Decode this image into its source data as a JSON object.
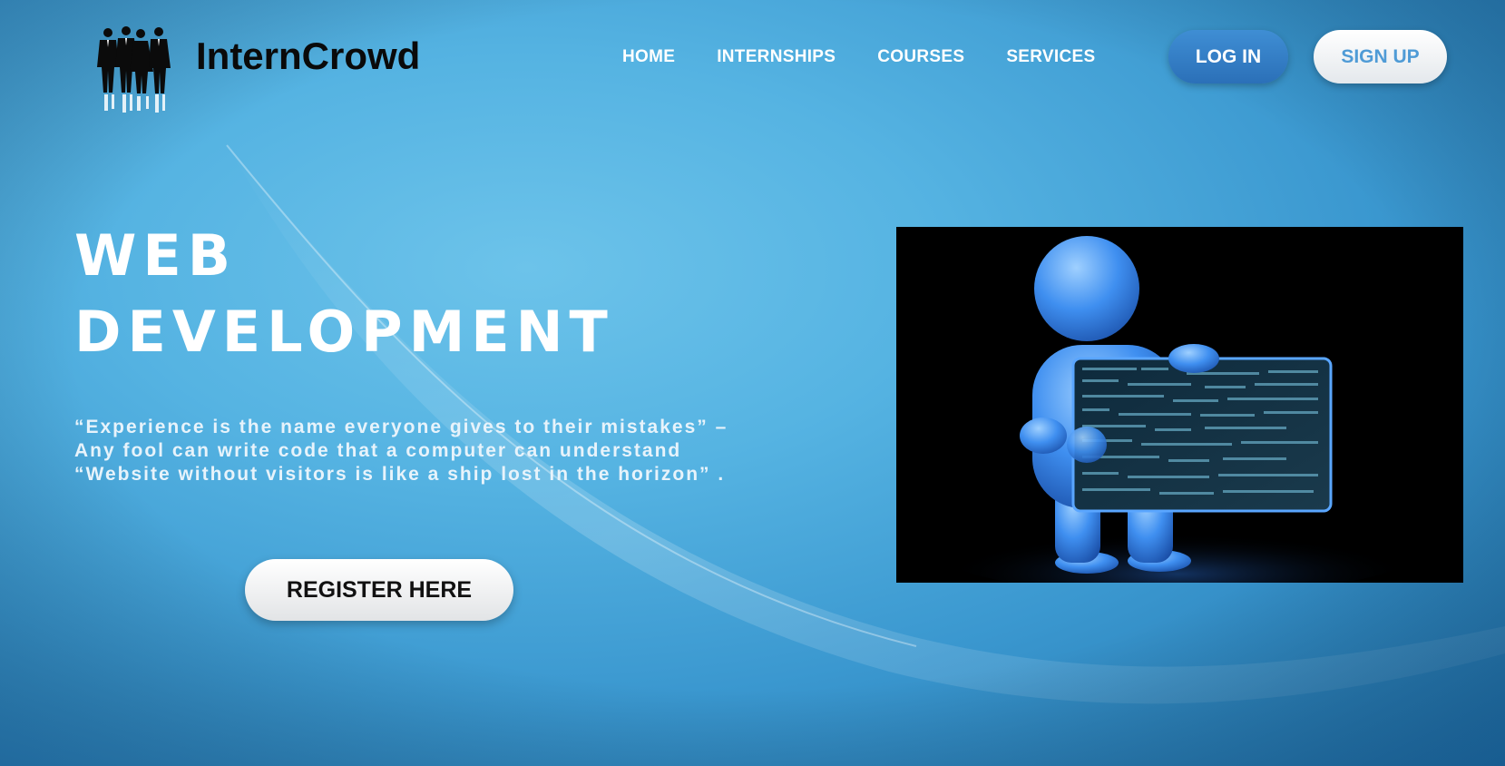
{
  "brand": {
    "name": "InternCrowd",
    "logo_icon": "business-team-silhouette"
  },
  "nav": {
    "items": [
      {
        "label": "HOME"
      },
      {
        "label": "INTERNSHIPS"
      },
      {
        "label": "COURSES"
      },
      {
        "label": "SERVICES"
      }
    ]
  },
  "auth": {
    "login_label": "LOG IN",
    "signup_label": "SIGN UP"
  },
  "hero": {
    "title_line1": "WEB",
    "title_line2": "DEVELOPMENT",
    "quote_lines": [
      "“Experience is the name everyone gives to their mistakes” –",
      "Any fool can write code that a computer can understand",
      "“Website without visitors is like a ship lost in the horizon” ."
    ],
    "cta_label": "REGISTER HERE",
    "image_icon": "figure-holding-code-screen"
  },
  "colors": {
    "background": "#55b3e2",
    "login_button": "#3a84c9",
    "signup_text": "#4f9bd6",
    "text_light": "#ffffff"
  }
}
